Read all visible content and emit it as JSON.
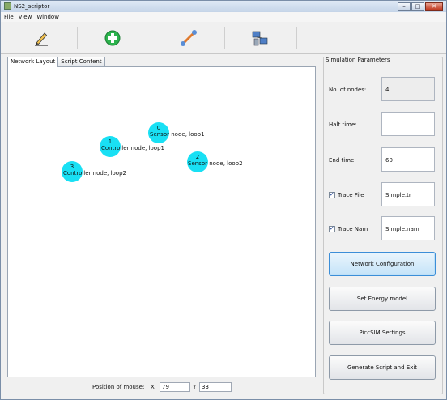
{
  "window": {
    "title": "NS2_scriptor"
  },
  "menu": [
    "File",
    "View",
    "Window"
  ],
  "toolbar": {
    "buttons": [
      {
        "icon": "pencil-icon"
      },
      {
        "icon": "add-green-icon"
      },
      {
        "icon": "link-tool-icon"
      },
      {
        "icon": "network-computers-icon"
      }
    ]
  },
  "tabs": [
    {
      "label": "Network Layout",
      "active": true
    },
    {
      "label": "Script Content",
      "active": false
    }
  ],
  "nodes": [
    {
      "id": "0",
      "label": "Sensor node, loop1"
    },
    {
      "id": "1",
      "label": "Controller node, loop1"
    },
    {
      "id": "2",
      "label": "Sensor node, loop2"
    },
    {
      "id": "3",
      "label": "Controller node, loop2"
    }
  ],
  "status": {
    "label": "Position of mouse:",
    "x_label": "X",
    "x_value": "79",
    "y_label": "Y",
    "y_value": "33"
  },
  "params": {
    "title": "Simulation Parameters",
    "nodes_label": "No. of nodes:",
    "nodes_value": "4",
    "halt_label": "Halt time:",
    "halt_value": "",
    "end_label": "End time:",
    "end_value": "60",
    "trace_file_label": "Trace File",
    "trace_file_value": "Simple.tr",
    "trace_nam_label": "Trace Nam",
    "trace_nam_value": "Simple.nam",
    "buttons": [
      "Network Configuration",
      "Set Energy model",
      "PiccSIM Settings",
      "Generate Script and Exit"
    ]
  },
  "colors": {
    "node": "#19e0f4",
    "focus_button": "#3b8ed8"
  }
}
